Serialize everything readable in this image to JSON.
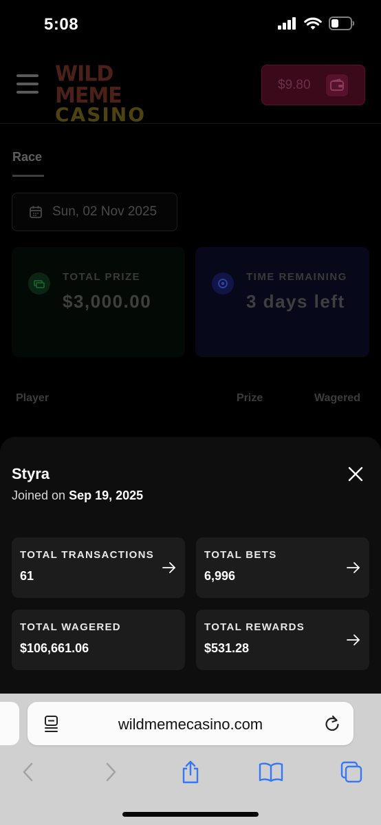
{
  "status_bar": {
    "time": "5:08"
  },
  "header": {
    "logo_line1": "WILD MEME",
    "logo_line2": "CASINO",
    "wallet_balance": "$9.80"
  },
  "race": {
    "tab_label": "Race",
    "date": "Sun, 02 Nov 2025",
    "total_prize_label": "TOTAL PRIZE",
    "total_prize_value": "$3,000.00",
    "time_remaining_label": "TIME REMAINING",
    "time_remaining_value": "3 days left",
    "columns": [
      "Player",
      "Prize",
      "Wagered"
    ]
  },
  "profile": {
    "name": "Styra",
    "joined_prefix": "Joined on",
    "joined_date": "Sep 19, 2025",
    "metrics": [
      {
        "label": "TOTAL TRANSACTIONS",
        "value": "61"
      },
      {
        "label": "TOTAL BETS",
        "value": "6,996"
      },
      {
        "label": "TOTAL WAGERED",
        "value": "$106,661.06"
      },
      {
        "label": "TOTAL REWARDS",
        "value": "$531.28"
      }
    ]
  },
  "browser": {
    "url": "wildmemecasino.com"
  },
  "colors": {
    "sheet_bg": "#0e0e0e",
    "card_bg": "#1c1c1c",
    "safari_blue": "#3478f6",
    "wallet_accent": "#3a0a1a"
  }
}
